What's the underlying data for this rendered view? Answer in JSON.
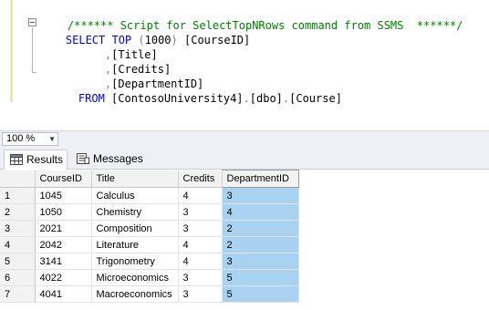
{
  "editor": {
    "lines": [
      {
        "parts": [
          {
            "cls": "cm",
            "text": "/****** Script for SelectTopNRows command from SSMS  ******/"
          }
        ]
      },
      {
        "parts": [
          {
            "cls": "kw",
            "text": "SELECT TOP "
          },
          {
            "cls": "gr",
            "text": "("
          },
          {
            "cls": "tx",
            "text": "1000"
          },
          {
            "cls": "gr",
            "text": ")"
          },
          {
            "cls": "tx",
            "text": " [CourseID]"
          }
        ]
      },
      {
        "parts": [
          {
            "cls": "gr",
            "text": ","
          },
          {
            "cls": "tx",
            "text": "[Title]"
          }
        ]
      },
      {
        "parts": [
          {
            "cls": "gr",
            "text": ","
          },
          {
            "cls": "tx",
            "text": "[Credits]"
          }
        ]
      },
      {
        "parts": [
          {
            "cls": "gr",
            "text": ","
          },
          {
            "cls": "tx",
            "text": "[DepartmentID]"
          }
        ]
      },
      {
        "parts": [
          {
            "cls": "kw",
            "text": "FROM "
          },
          {
            "cls": "tx",
            "text": "[ContosoUniversity4]"
          },
          {
            "cls": "gr",
            "text": "."
          },
          {
            "cls": "tx",
            "text": "[dbo]"
          },
          {
            "cls": "gr",
            "text": "."
          },
          {
            "cls": "tx",
            "text": "[Course]"
          }
        ]
      }
    ]
  },
  "zoom": {
    "value": "100 %",
    "arrow_icon": "chevron-down-icon"
  },
  "tabs": [
    {
      "label": "Results",
      "icon": "grid-icon",
      "active": true
    },
    {
      "label": "Messages",
      "icon": "messages-icon",
      "active": false
    }
  ],
  "grid": {
    "columns": [
      "CourseID",
      "Title",
      "Credits",
      "DepartmentID"
    ],
    "rows": [
      {
        "num": "1",
        "cells": [
          "1045",
          "Calculus",
          "4",
          "3"
        ]
      },
      {
        "num": "2",
        "cells": [
          "1050",
          "Chemistry",
          "3",
          "4"
        ]
      },
      {
        "num": "3",
        "cells": [
          "2021",
          "Composition",
          "3",
          "2"
        ]
      },
      {
        "num": "4",
        "cells": [
          "2042",
          "Literature",
          "4",
          "2"
        ]
      },
      {
        "num": "5",
        "cells": [
          "3141",
          "Trigonometry",
          "4",
          "3"
        ]
      },
      {
        "num": "6",
        "cells": [
          "4022",
          "Microeconomics",
          "3",
          "5"
        ]
      },
      {
        "num": "7",
        "cells": [
          "4041",
          "Macroeconomics",
          "3",
          "5"
        ]
      }
    ],
    "selected_column_color": "#a9d2f0"
  }
}
